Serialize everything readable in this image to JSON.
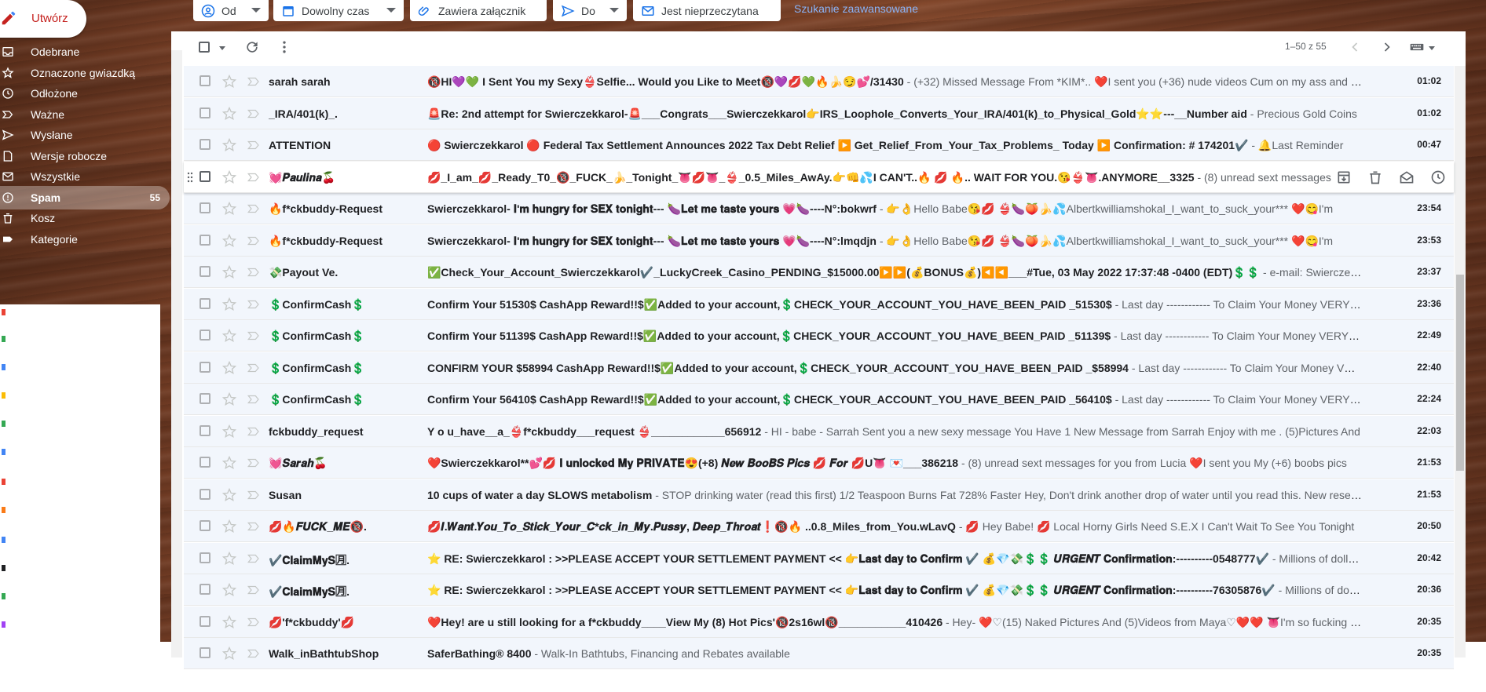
{
  "compose": {
    "label": "Utwórz"
  },
  "filters": {
    "from": "Od",
    "time": "Dowolny czas",
    "attachment": "Zawiera załącznik",
    "to": "Do",
    "unread": "Jest nieprzeczytana",
    "advanced": "Szukanie zaawansowane"
  },
  "sidebar": {
    "items": [
      {
        "label": "Odebrane",
        "icon": "inbox-icon"
      },
      {
        "label": "Oznaczone gwiazdką",
        "icon": "star-icon"
      },
      {
        "label": "Odłożone",
        "icon": "clock-icon"
      },
      {
        "label": "Ważne",
        "icon": "important-icon"
      },
      {
        "label": "Wysłane",
        "icon": "send-icon"
      },
      {
        "label": "Wersje robocze",
        "icon": "draft-icon"
      },
      {
        "label": "Wszystkie",
        "icon": "mail-icon"
      },
      {
        "label": "Spam",
        "icon": "spam-icon",
        "count": "55",
        "active": true
      },
      {
        "label": "Kosz",
        "icon": "trash-icon"
      },
      {
        "label": "Kategorie",
        "icon": "label-icon"
      }
    ]
  },
  "toolbar": {
    "pager": "1–50 z 55"
  },
  "emails": [
    {
      "sender": "sarah sarah",
      "subject": "🔞HI💜💚 I Sent You my Sexy👙Selfie... Would you Like to Meet🔞💜💋💚🔥🍌😏💕/31430",
      "snippet": " - (+32) Missed Message From *KIM*.. ❤️I sent you (+36) nude videos Cum on my ass and pussy",
      "time": "01:02"
    },
    {
      "sender": "_IRA/401(k)_.",
      "subject": "🚨Re: 2nd attempt for Swierczekkarol-🚨___Congrats___Swierczekkarol👉IRS_Loophole_Converts_Your_IRA/401(k)_to_Physical_Gold⭐⭐---__Number aid",
      "snippet": " - Precious Gold Coins",
      "time": "01:02"
    },
    {
      "sender": "ATTENTION",
      "subject": "🔴 Swierczekkarol 🔴 Federal Tax Settlement Announces 2022 Tax Debt Relief ▶️ Get_Relief_From_Your_Tax_Problems_ Today ▶️ Confirmation: # 174201✔️",
      "snippet": " - 🔔Last Reminder",
      "time": "00:47"
    },
    {
      "sender": "💓𝑷𝒂𝒖𝒍𝒊𝒏𝒂🍒",
      "subject": "💋_I_am_💋_Ready_T0_🔞_FUCK_🍌_Tonight_👅💋👅_👙_0.5_Miles_AwAy.👉👊💦I CAN'T..🔥 💋 🔥.. WAIT FOR YOU.😘👙👅.ANYMORE__3325",
      "snippet": " - (8) unread sext messages",
      "time": ""
    },
    {
      "sender": "🔥f*ckbuddy-Request",
      "subject": "Swierczekkarol- 𝐈'𝐦 𝐡𝐮𝐧𝐠𝐫𝐲 𝐟𝐨𝐫 𝐒𝐄𝐗 𝐭𝐨𝐧𝐢𝐠𝐡𝐭--- 🍆𝐋𝐞𝐭 𝐦𝐞 𝐭𝐚𝐬𝐭𝐞 𝐲𝐨𝐮𝐫𝐬 💗🍆----N°:bokwrf",
      "snippet": " - 👉👌Hello Babe😘💋 👙🍆🍑🍌💦Albertkwilliamshokal_I_want_to_suck_your*** ❤️😋I'm",
      "time": "23:54"
    },
    {
      "sender": "🔥f*ckbuddy-Request",
      "subject": "Swierczekkarol- 𝐈'𝐦 𝐡𝐮𝐧𝐠𝐫𝐲 𝐟𝐨𝐫 𝐒𝐄𝐗 𝐭𝐨𝐧𝐢𝐠𝐡𝐭--- 🍆𝐋𝐞𝐭 𝐦𝐞 𝐭𝐚𝐬𝐭𝐞 𝐲𝐨𝐮𝐫𝐬 💗🍆----N°:lmqdjn",
      "snippet": " - 👉👌Hello Babe😘💋 👙🍆🍑🍌💦Albertkwilliamshokal_I_want_to_suck_your*** ❤️😋I'm",
      "time": "23:53"
    },
    {
      "sender": "💸Payout Ve.",
      "subject": "✅Check_Your_Account_Swierczekkarol✔️_LuckyCreek_Casino_PENDING_$15000.00▶️▶️(💰BONUS💰)◀️◀️___#Tue, 03 May 2022 17:37:48 -0400 (EDT)💲💲",
      "snippet": " - e-mail: Swierczekkarol",
      "time": "23:37"
    },
    {
      "sender": "💲ConfirmCash💲",
      "subject": "Confirm Your 51530$ CashApp Reward!!$✅Added to your account,💲CHECK_YOUR_ACCOUNT_YOU_HAVE_BEEN_PAID _51530$",
      "snippet": " - Last day ------------ To Claim Your Money VERY_IMPORTANT",
      "time": "23:36"
    },
    {
      "sender": "💲ConfirmCash💲",
      "subject": "Confirm Your 51139$ CashApp Reward!!$✅Added to your account,💲CHECK_YOUR_ACCOUNT_YOU_HAVE_BEEN_PAID _51139$",
      "snippet": " - Last day ------------ To Claim Your Money VERY_IMPORTANT",
      "time": "22:49"
    },
    {
      "sender": "💲ConfirmCash💲",
      "subject": "CONFIRM YOUR $58994 CashApp Reward!!$✅Added to your account,💲CHECK_YOUR_ACCOUNT_YOU_HAVE_BEEN_PAID _$58994",
      "snippet": " - Last day ------------ To Claim Your Money VERY_IMPORTANT",
      "time": "22:40"
    },
    {
      "sender": "💲ConfirmCash💲",
      "subject": "Confirm Your 56410$ CashApp Reward!!$✅Added to your account,💲CHECK_YOUR_ACCOUNT_YOU_HAVE_BEEN_PAID _56410$",
      "snippet": " - Last day ------------ To Claim Your Money VERY_IMPORTANT",
      "time": "22:24"
    },
    {
      "sender": "fckbuddy_request",
      "subject": "Y o u_have__a_👙f*ckbuddy___request 👙____________656912",
      "snippet": " - HI - babe - Sarrah Sent you a new sexy message You Have 1 New Message from Sarrah Enjoy with me . (5)Pictures And",
      "time": "22:03"
    },
    {
      "sender": "💓𝑺𝒂𝒓𝒂𝒉🍒",
      "subject": "❤️Swierczekkarol**💕💋 𝐈 𝐮𝐧𝐥𝐨𝐜𝐤𝐞𝐝 𝐌𝐲 𝐏𝐑𝐈𝐕𝐀𝐓𝐄😍(+8) 𝑵𝒆𝒘 𝑩𝒐𝒐𝑩𝑺 𝑷𝒊𝒄𝒔 💋 𝑭𝒐𝒓 💋U👅 💌___386218",
      "snippet": " - (8) unread sext messages for you from Lucia ❤️I sent you My (+6) boobs pics",
      "time": "21:53"
    },
    {
      "sender": "Susan",
      "subject": "10 cups of water a day SLOWS metabolism",
      "snippet": " - STOP drinking water (read this first) 1/2 Teaspoon Burns Fat 728% Faster Hey, Don't drink another drop of water until you read this. New research",
      "time": "21:53"
    },
    {
      "sender": "💋🔥𝑭𝑼𝑪𝑲_𝑴𝑬🔞.",
      "subject": "💋𝑰.𝑾𝒂𝒏𝒕.𝒀𝒐𝒖_𝑻𝒐_𝑺𝒕𝒊𝒄𝒌_𝒀𝒐𝒖𝒓_𝑪*𝒄𝒌_𝒊𝒏_𝑴𝒚.𝑷𝒖𝒔𝒔𝒚, 𝑫𝒆𝒆𝒑_𝑻𝒉𝒓𝒐𝒂𝒕❗🔞🔥 ..0.8_Miles_from_You.wLavQ",
      "snippet": " - 💋 Hey Babe! 💋 Local Horny Girls Need S.E.X I Can't Wait To See You Tonight",
      "time": "20:50"
    },
    {
      "sender": "✔️𝐂𝐥𝐚𝐢𝐦𝐌𝐲𝐒🈷.",
      "subject": "⭐ RE: Swierczekkarol : >>PLEASE ACCEPT YOUR SETTLEMENT PAYMENT << 👉𝐋𝐚𝐬𝐭 𝐝𝐚𝐲 𝐭𝐨 𝐂𝐨𝐧𝐟𝐢𝐫𝐦 ✔️ 💰💎💸💲💲 𝑼𝑹𝑮𝑬𝑵𝑻 𝐂𝐨𝐧𝐟𝐢𝐫𝐦𝐚𝐭𝐢𝐨𝐧:----------0548777✔️",
      "snippet": " - Millions of dollars",
      "time": "20:42"
    },
    {
      "sender": "✔️𝐂𝐥𝐚𝐢𝐦𝐌𝐲𝐒🈷.",
      "subject": "⭐ RE: Swierczekkarol : >>PLEASE ACCEPT YOUR SETTLEMENT PAYMENT << 👉𝐋𝐚𝐬𝐭 𝐝𝐚𝐲 𝐭𝐨 𝐂𝐨𝐧𝐟𝐢𝐫𝐦 ✔️ 💰💎💸💲💲 𝑼𝑹𝑮𝑬𝑵𝑻 𝐂𝐨𝐧𝐟𝐢𝐫𝐦𝐚𝐭𝐢𝐨𝐧:----------76305876✔️",
      "snippet": " - Millions of dollars",
      "time": "20:36"
    },
    {
      "sender": "💋'f*ckbuddy'💋",
      "subject": "❤️Hey! are u still looking for a f*ckbuddy____View My (8) Hot Pics'🔞2s16wl🔞___________410426",
      "snippet": " - Hey- ❤️♡(15) Naked Pictures And (5)Videos from Maya♡❤️❤️ 👅I'm so fucking horny",
      "time": "20:35"
    },
    {
      "sender": "Walk_inBathtubShop",
      "subject": "SaferBathing® 8400",
      "snippet": " - Walk-In Bathtubs, Financing and Rebates available",
      "time": "20:35"
    }
  ]
}
